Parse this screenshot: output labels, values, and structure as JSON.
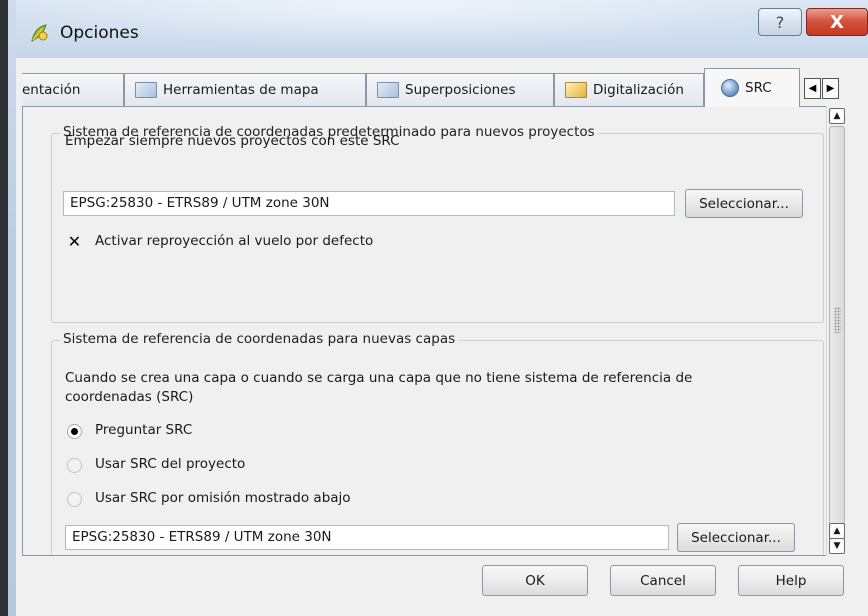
{
  "window": {
    "title": "Opciones",
    "help_glyph": "?",
    "close_glyph": "X"
  },
  "tabs": [
    {
      "label": "entación",
      "icon": "document-icon",
      "active": false
    },
    {
      "label": "Herramientas de mapa",
      "icon": "map-tools-icon",
      "active": false
    },
    {
      "label": "Superposiciones",
      "icon": "overlay-icon",
      "active": false
    },
    {
      "label": "Digitalización",
      "icon": "digitize-icon",
      "active": false
    },
    {
      "label": "SRC",
      "icon": "globe-icon",
      "active": true
    }
  ],
  "tab_scroll": {
    "left": "◀",
    "right": "▶"
  },
  "default_project_crs": {
    "title": "Sistema de referencia de coordenadas predeterminado para nuevos proyectos",
    "always_start_label": "Empezar siempre nuevos proyectos con este SRC",
    "crs_value": "EPSG:25830 - ETRS89 / UTM zone 30N",
    "select_button": "Seleccionar...",
    "otf_reprojection_label": "Activar reproyección al vuelo por defecto",
    "otf_reprojection_checked": true
  },
  "new_layers_crs": {
    "title": "Sistema de referencia de coordenadas para nuevas capas",
    "description_line1": "Cuando se crea una capa o cuando se carga una capa que no tiene sistema de referencia de",
    "description_line2": "coordenadas (SRC)",
    "options": [
      {
        "label": "Preguntar SRC",
        "selected": true
      },
      {
        "label": "Usar SRC del proyecto",
        "selected": false
      },
      {
        "label": "Usar SRC por omisión mostrado abajo",
        "selected": false
      }
    ],
    "crs_value": "EPSG:25830 - ETRS89 / UTM zone 30N",
    "select_button": "Seleccionar..."
  },
  "scrollbar": {
    "up": "▲",
    "down": "▼"
  },
  "buttons": {
    "ok": "OK",
    "cancel": "Cancel",
    "help": "Help"
  }
}
